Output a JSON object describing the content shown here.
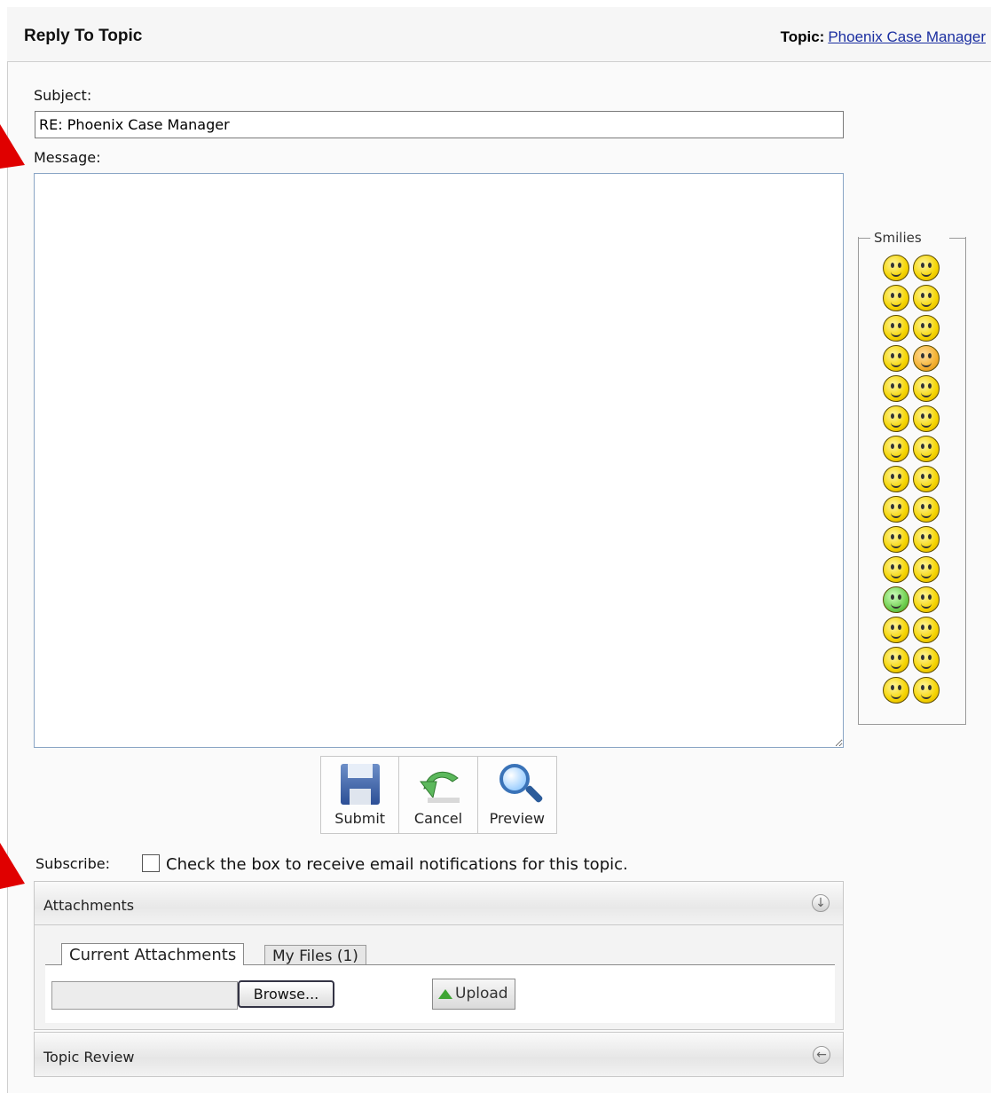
{
  "header": {
    "title": "Reply To Topic",
    "topic_label": "Topic:",
    "topic_link": "Phoenix Case Manager"
  },
  "form": {
    "subject_label": "Subject:",
    "subject_value": "RE: Phoenix Case Manager",
    "message_label": "Message:",
    "message_value": ""
  },
  "smilies": {
    "legend": "Smilies",
    "count": 30
  },
  "toolbar": {
    "submit_label": "Submit",
    "cancel_label": "Cancel",
    "preview_label": "Preview"
  },
  "subscribe": {
    "label": "Subscribe:",
    "text": "Check the box to receive email notifications for this topic.",
    "checked": false
  },
  "attachments": {
    "title": "Attachments",
    "tabs": [
      "Current Attachments",
      "My Files (1)"
    ],
    "browse_label": "Browse...",
    "upload_label": "Upload"
  },
  "topic_review": {
    "title": "Topic Review"
  },
  "colors": {
    "link": "#1a2ea0",
    "annotation_arrow": "#e00000",
    "upload_arrow": "#3fa534"
  },
  "icons": [
    "save-disk-icon",
    "undo-arrow-icon",
    "magnifier-icon",
    "collapse-down-icon",
    "expand-left-icon",
    "upload-arrow-icon"
  ]
}
